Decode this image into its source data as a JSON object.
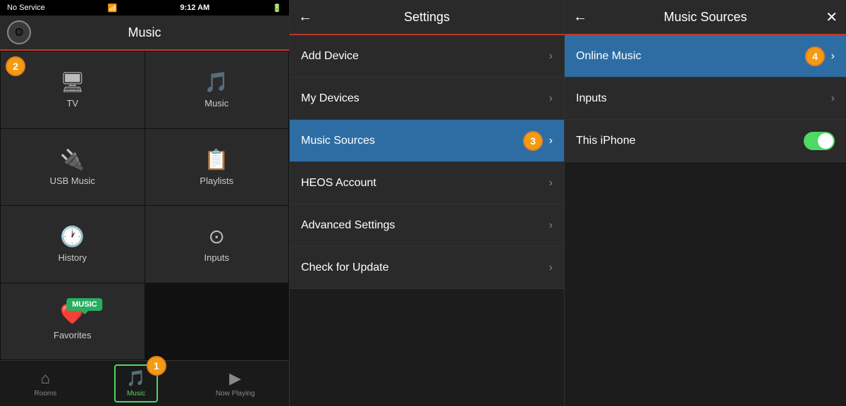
{
  "statusBar": {
    "signal": "No Service",
    "wifi": "wifi",
    "time": "9:12 AM",
    "battery": "battery"
  },
  "panel1": {
    "title": "Music",
    "gear": "⚙",
    "gridItems": [
      {
        "icon": "🖥",
        "label": "TV"
      },
      {
        "icon": "♪",
        "label": "Music"
      },
      {
        "icon": "⚡",
        "label": "USB Music"
      },
      {
        "icon": "≡♪",
        "label": "Playlists"
      },
      {
        "icon": "⏱",
        "label": "History"
      },
      {
        "icon": "⊙",
        "label": "Inputs"
      },
      {
        "icon": "♥",
        "label": "Favorites"
      }
    ],
    "tabs": [
      {
        "icon": "⌂",
        "label": "Rooms",
        "active": false
      },
      {
        "icon": "♪",
        "label": "Music",
        "active": true
      },
      {
        "icon": "▶",
        "label": "Now Playing",
        "active": false
      }
    ],
    "tooltip": "MUSIC",
    "badge": "1"
  },
  "panel2": {
    "title": "Settings",
    "backIcon": "←",
    "items": [
      {
        "label": "Add Device",
        "active": false
      },
      {
        "label": "My Devices",
        "active": false
      },
      {
        "label": "Music Sources",
        "active": true
      },
      {
        "label": "HEOS Account",
        "active": false
      },
      {
        "label": "Advanced Settings",
        "active": false
      },
      {
        "label": "Check for Update",
        "active": false
      }
    ],
    "badge": "3"
  },
  "panel3": {
    "title": "Music Sources",
    "backIcon": "←",
    "closeIcon": "✕",
    "items": [
      {
        "label": "Online Music",
        "active": true,
        "hasToggle": false
      },
      {
        "label": "Inputs",
        "active": false,
        "hasToggle": false
      },
      {
        "label": "This iPhone",
        "active": false,
        "hasToggle": true,
        "toggleOn": true
      }
    ],
    "badge": "4"
  }
}
